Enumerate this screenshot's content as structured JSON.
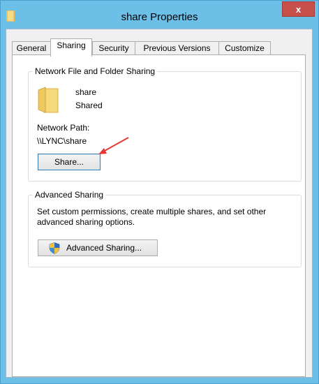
{
  "window": {
    "title": "share Properties",
    "close_label": "x",
    "title_icon": "folder-icon"
  },
  "tabs": [
    {
      "label": "General",
      "active": false
    },
    {
      "label": "Sharing",
      "active": true
    },
    {
      "label": "Security",
      "active": false
    },
    {
      "label": "Previous Versions",
      "active": false
    },
    {
      "label": "Customize",
      "active": false
    }
  ],
  "network_sharing": {
    "group_label": "Network File and Folder Sharing",
    "folder_name": "share",
    "folder_status": "Shared",
    "path_label": "Network Path:",
    "path_value": "\\\\LYNC\\share",
    "share_button": "Share..."
  },
  "advanced_sharing": {
    "group_label": "Advanced Sharing",
    "description_line1": "Set custom permissions, create multiple shares, and set other",
    "description_line2": "advanced sharing options.",
    "button_label": "Advanced Sharing...",
    "button_icon": "uac-shield-icon"
  },
  "annotation": {
    "icon": "red-arrow-icon",
    "color": "#e53935"
  }
}
